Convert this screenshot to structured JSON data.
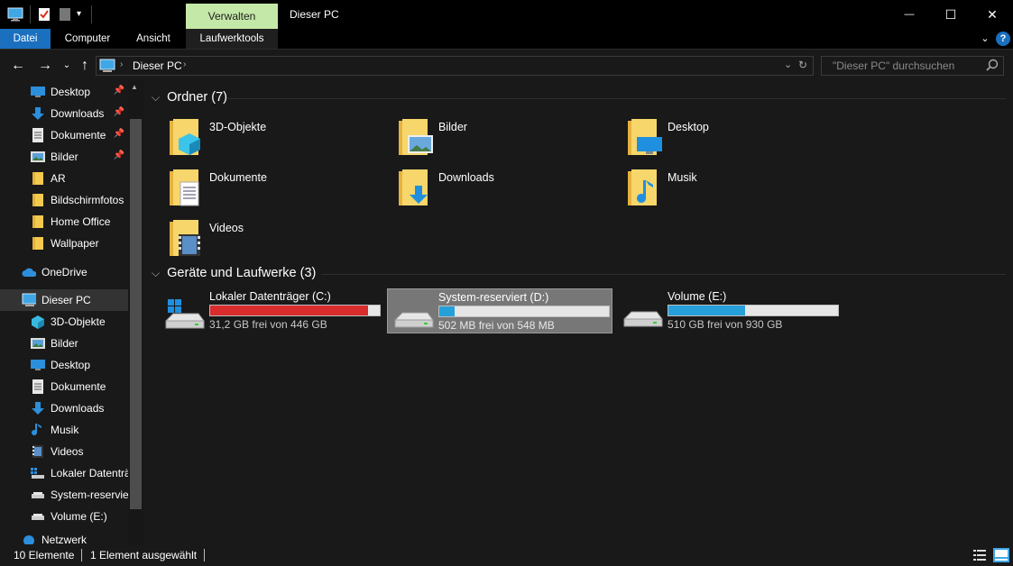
{
  "window": {
    "title": "Dieser PC",
    "contextual_tab": "Verwalten",
    "controls": {
      "minimize": "—",
      "maximize": "☐",
      "close": "✕"
    }
  },
  "ribbon": {
    "tabs": [
      "Datei",
      "Computer",
      "Ansicht",
      "Laufwerktools"
    ]
  },
  "address": {
    "path": "Dieser PC",
    "search_placeholder": "\"Dieser PC\" durchsuchen"
  },
  "sidebar": {
    "quick_access": [
      {
        "label": "Desktop",
        "icon": "desktop-icon",
        "pinned": true
      },
      {
        "label": "Downloads",
        "icon": "download-icon",
        "pinned": true
      },
      {
        "label": "Dokumente",
        "icon": "document-icon",
        "pinned": true
      },
      {
        "label": "Bilder",
        "icon": "pictures-icon",
        "pinned": true
      },
      {
        "label": "AR",
        "icon": "folder-icon",
        "pinned": false
      },
      {
        "label": "Bildschirmfotos",
        "icon": "folder-icon",
        "pinned": false
      },
      {
        "label": "Home Office",
        "icon": "folder-icon",
        "pinned": false
      },
      {
        "label": "Wallpaper",
        "icon": "folder-icon",
        "pinned": false
      }
    ],
    "onedrive": "OneDrive",
    "this_pc": "Dieser PC",
    "this_pc_children": [
      {
        "label": "3D-Objekte",
        "icon": "3d-objects-icon"
      },
      {
        "label": "Bilder",
        "icon": "pictures-icon"
      },
      {
        "label": "Desktop",
        "icon": "desktop-icon"
      },
      {
        "label": "Dokumente",
        "icon": "document-icon"
      },
      {
        "label": "Downloads",
        "icon": "download-icon"
      },
      {
        "label": "Musik",
        "icon": "music-icon"
      },
      {
        "label": "Videos",
        "icon": "video-icon"
      },
      {
        "label": "Lokaler Datenträger (C:)",
        "icon": "drive-icon"
      },
      {
        "label": "System-reserviert (D:)",
        "icon": "drive-icon"
      },
      {
        "label": "Volume (E:)",
        "icon": "drive-icon"
      }
    ],
    "network": "Netzwerk"
  },
  "main": {
    "folders_header": "Ordner (7)",
    "folders": [
      {
        "label": "3D-Objekte",
        "icon": "3d-objects-folder-icon"
      },
      {
        "label": "Bilder",
        "icon": "pictures-folder-icon"
      },
      {
        "label": "Desktop",
        "icon": "desktop-folder-icon"
      },
      {
        "label": "Dokumente",
        "icon": "documents-folder-icon"
      },
      {
        "label": "Downloads",
        "icon": "downloads-folder-icon"
      },
      {
        "label": "Musik",
        "icon": "music-folder-icon"
      },
      {
        "label": "Videos",
        "icon": "videos-folder-icon"
      }
    ],
    "drives_header": "Geräte und Laufwerke (3)",
    "drives": [
      {
        "label": "Lokaler Datenträger (C:)",
        "info": "31,2 GB frei von 446 GB",
        "used_fraction": 0.93,
        "color": "#d92c2c",
        "selected": false,
        "windows": true
      },
      {
        "label": "System-reserviert (D:)",
        "info": "502 MB frei von 548 MB",
        "used_fraction": 0.09,
        "color": "#26a0da",
        "selected": true,
        "windows": false
      },
      {
        "label": "Volume (E:)",
        "info": "510 GB frei von 930 GB",
        "used_fraction": 0.45,
        "color": "#26a0da",
        "selected": false,
        "windows": false
      }
    ]
  },
  "status": {
    "count": "10 Elemente",
    "selection": "1 Element ausgewählt"
  }
}
